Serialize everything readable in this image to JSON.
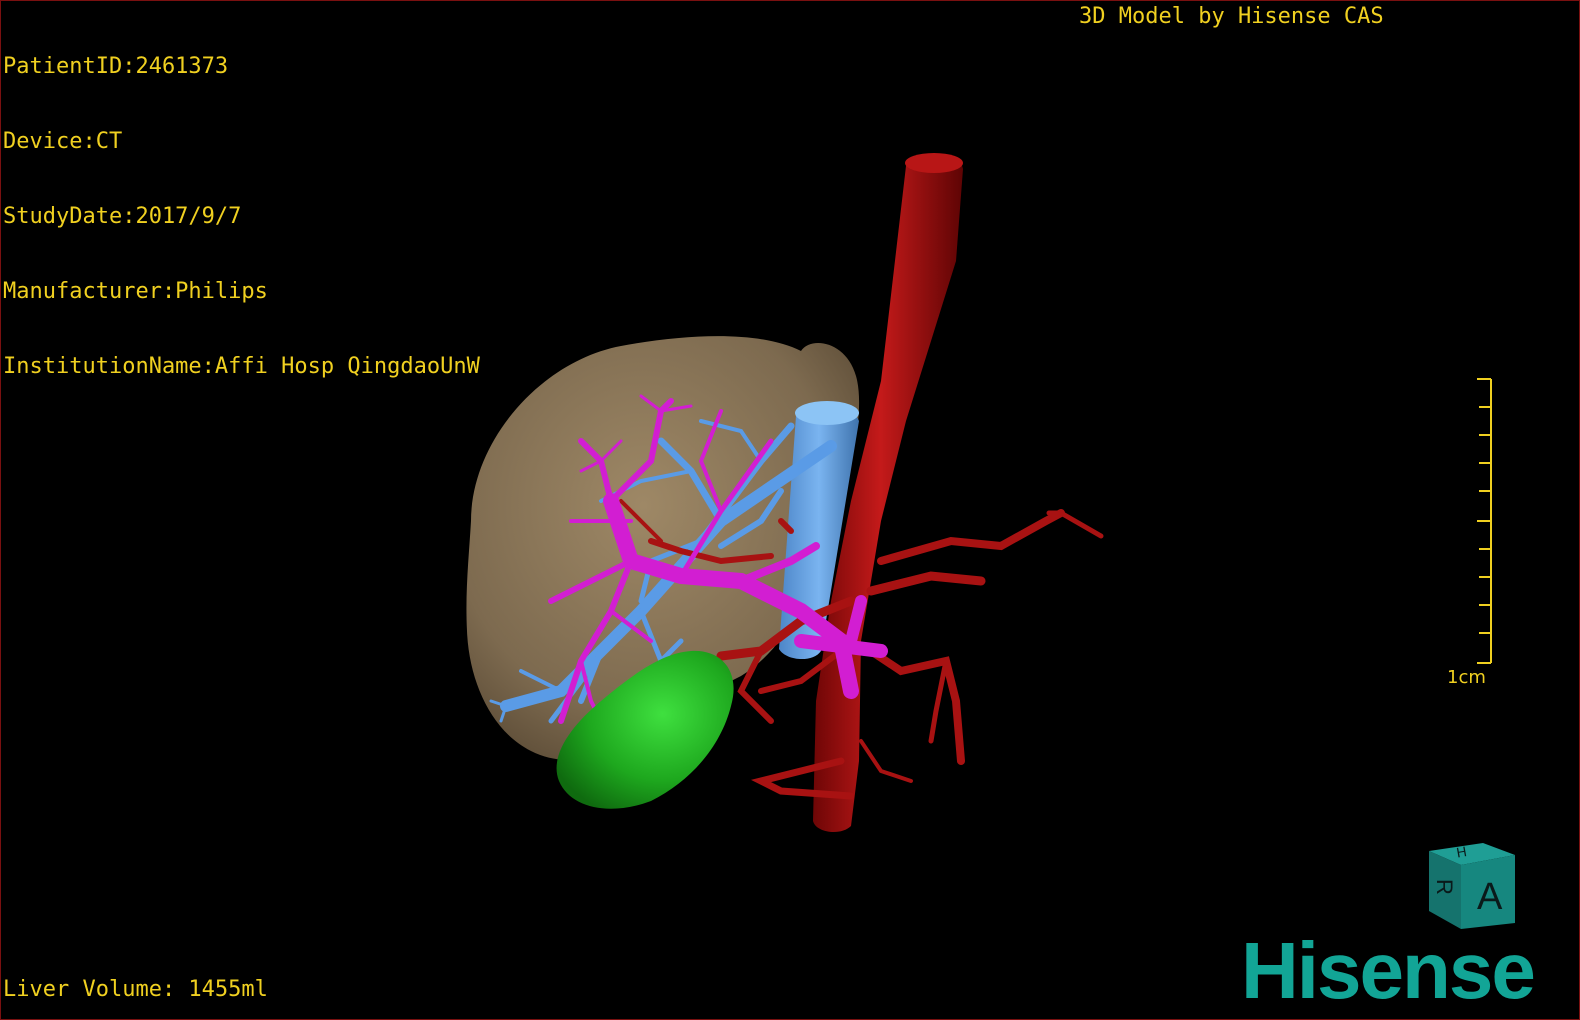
{
  "header": {
    "patient_id": "PatientID:2461373",
    "device": "Device:CT",
    "study_date": "StudyDate:2017/9/7",
    "manufacturer": "Manufacturer:Philips",
    "institution": "InstitutionName:Affi Hosp QingdaoUnW"
  },
  "title": "3D Model by Hisense CAS",
  "footer": {
    "volume": "Liver Volume: 1455ml"
  },
  "scale_bar": {
    "label": "1cm"
  },
  "orientation_cube": {
    "face_front": "A",
    "face_top": "H",
    "face_side": "R"
  },
  "brand": {
    "logo_text": "Hisense",
    "color": "#12a596"
  },
  "colors": {
    "text": "#f0d020",
    "liver": "#8a7558",
    "gallbladder": "#1ea81e",
    "artery": "#a81212",
    "portal_vein": "#d21ed2",
    "hepatic_vein": "#5a9be6"
  }
}
